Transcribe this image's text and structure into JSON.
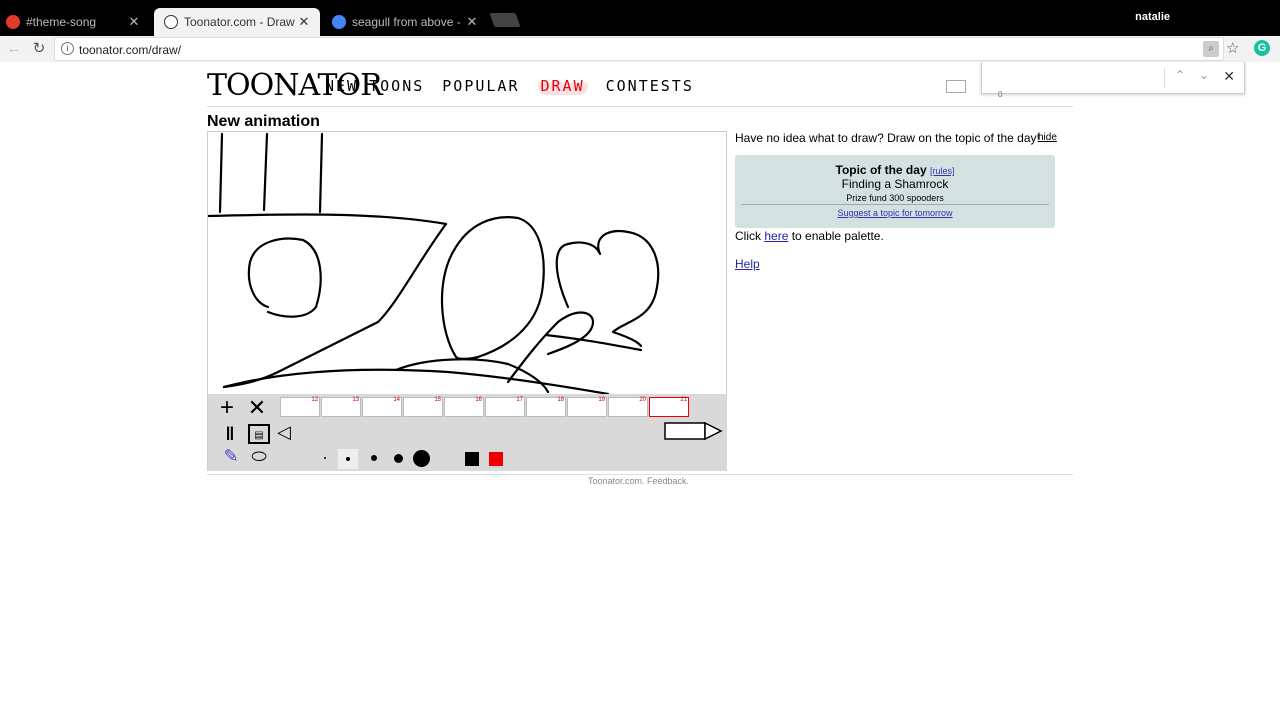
{
  "browser": {
    "tabs": [
      {
        "title": "#theme-song",
        "favicon_color": "#e23a2e"
      },
      {
        "title": "Toonator.com - Draw animations",
        "favicon_color": "#ffffff"
      },
      {
        "title": "seagull from above - Google Search",
        "favicon_color": "#4285f4"
      }
    ],
    "close_glyph": "✕",
    "user": "natalie",
    "url": "toonator.com/draw/",
    "find_up": "⌃",
    "find_down": "⌄",
    "find_close": "✕"
  },
  "site": {
    "logo": "TOONATOR",
    "nav": {
      "new_toons": "NEW TOONS",
      "popular": "POPULAR",
      "draw": "DRAW",
      "contests": "CONTESTS"
    },
    "mail_count": "0"
  },
  "page": {
    "title": "New animation"
  },
  "editor": {
    "frames": [
      "12",
      "13",
      "14",
      "15",
      "16",
      "17",
      "18",
      "19",
      "20",
      "21"
    ],
    "current_frame": "21",
    "brush_sizes": 5,
    "colors": [
      "#000000",
      "#ee0000"
    ]
  },
  "sidebar": {
    "hint": "Have no idea what to draw? Draw on the topic of the day!",
    "hide": "hide",
    "topic_label": "Topic of the day",
    "rules": "[rules]",
    "topic": "Finding a Shamrock",
    "prize": "Prize fund 300 spooders",
    "suggest": "Suggest a topic for tomorrow",
    "palette_pre": "Click",
    "palette_link": "here",
    "palette_post": "to enable palette.",
    "help": "Help"
  },
  "footer": "Toonator.com. Feedback."
}
